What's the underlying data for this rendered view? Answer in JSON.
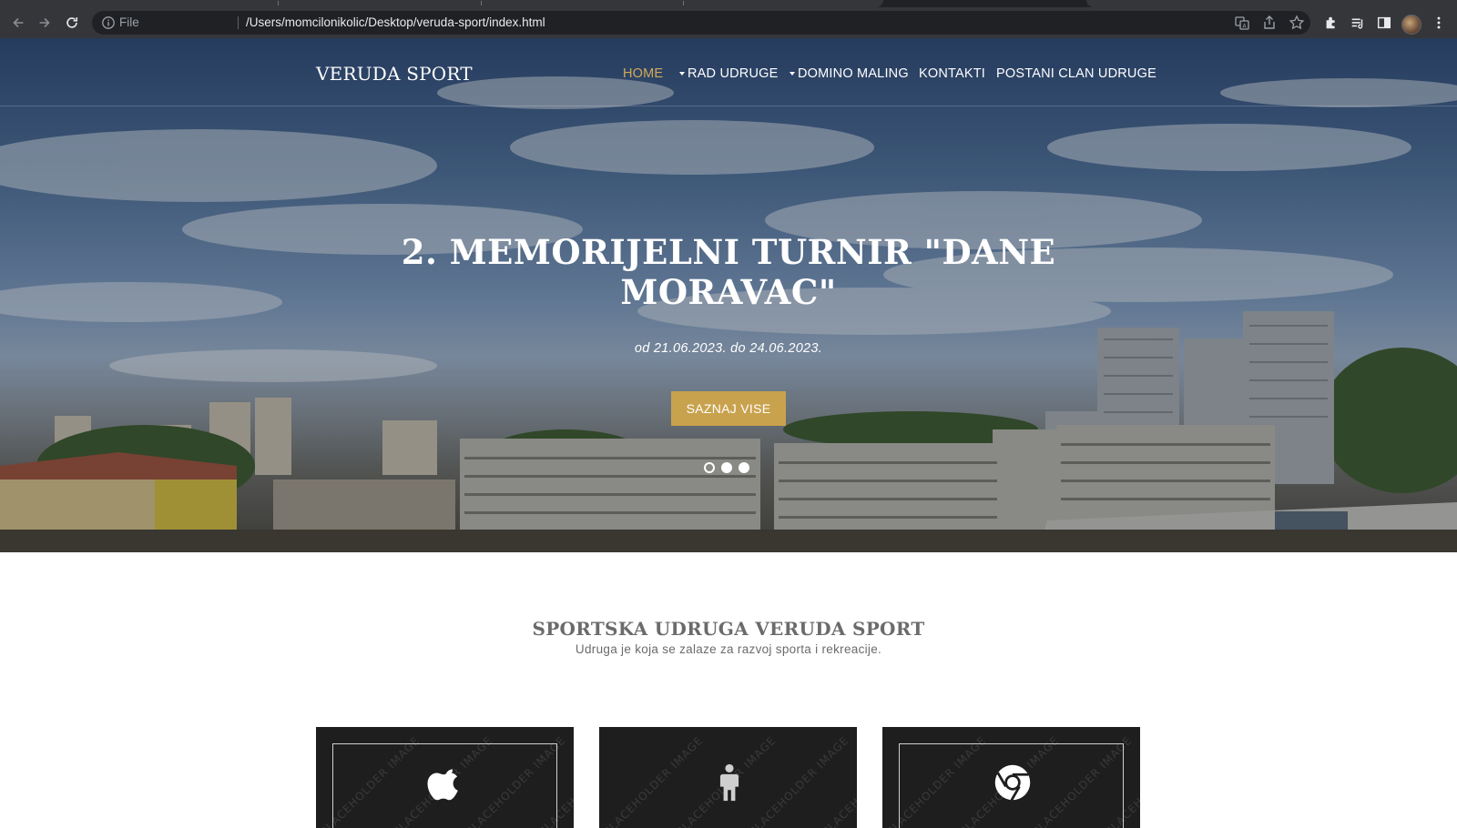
{
  "browser": {
    "file_label": "File",
    "url": "/Users/momcilonikolic/Desktop/veruda-sport/index.html"
  },
  "site": {
    "brand": "VERUDA SPORT",
    "nav": [
      {
        "label": "HOME",
        "active": true,
        "has_caret": false
      },
      {
        "label": "RAD UDRUGE",
        "active": false,
        "has_caret": true
      },
      {
        "label": "DOMINO MALING",
        "active": false,
        "has_caret": true
      },
      {
        "label": "KONTAKTI",
        "active": false,
        "has_caret": false
      },
      {
        "label": "POSTANI CLAN UDRUGE",
        "active": false,
        "has_caret": false
      }
    ]
  },
  "hero": {
    "title_line1": "2. MEMORIJELNI TURNIR \"DANE",
    "title_line2": "MORAVAC\"",
    "subtitle": "od 21.06.2023. do 24.06.2023.",
    "cta_label": "SAZNAJ VISE",
    "slides_count": 3,
    "active_slide": 1
  },
  "intro": {
    "title": "SPORTSKA UDRUGA VERUDA SPORT",
    "subtitle": "Udruga je koja se zalaze za razvoj sporta i rekreacije."
  },
  "cards": [
    {
      "icon": "apple-icon"
    },
    {
      "icon": "person-icon"
    },
    {
      "icon": "chrome-icon"
    }
  ],
  "colors": {
    "accent": "#c9a24e",
    "nav_active": "#d1aa5a",
    "card_bg": "#1e1e1e",
    "text_gray": "#6b6b6b"
  }
}
